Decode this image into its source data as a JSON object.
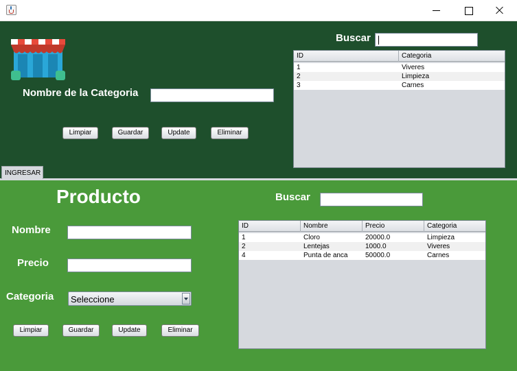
{
  "categoria_panel": {
    "name_label": "Nombre de la Categoria",
    "name_value": "",
    "search_label": "Buscar",
    "search_value": "",
    "buttons": {
      "limpiar": "Limpiar",
      "guardar": "Guardar",
      "update": "Update",
      "eliminar": "Eliminar"
    },
    "table": {
      "columns": [
        "ID",
        "Categoria"
      ],
      "rows": [
        [
          "1",
          "Viveres"
        ],
        [
          "2",
          "Limpieza"
        ],
        [
          "3",
          "Carnes"
        ]
      ]
    },
    "tab_label": "INGRESAR"
  },
  "producto_panel": {
    "title": "Producto",
    "search_label": "Buscar",
    "search_value": "",
    "nombre_label": "Nombre",
    "nombre_value": "",
    "precio_label": "Precio",
    "precio_value": "",
    "categoria_label": "Categoria",
    "categoria_selected": "Seleccione",
    "buttons": {
      "limpiar": "Limpiar",
      "guardar": "Guardar",
      "update": "Update",
      "eliminar": "Eliminar"
    },
    "table": {
      "columns": [
        "ID",
        "Nombre",
        "Precio",
        "Categoria"
      ],
      "rows": [
        [
          "1",
          "Cloro",
          "20000.0",
          "Limpieza"
        ],
        [
          "2",
          "Lentejas",
          "1000.0",
          "Viveres"
        ],
        [
          "4",
          "Punta de anca",
          "50000.0",
          "Carnes"
        ]
      ]
    }
  },
  "colors": {
    "top_panel": "#1e4f2c",
    "bottom_panel": "#4a9a3a"
  }
}
